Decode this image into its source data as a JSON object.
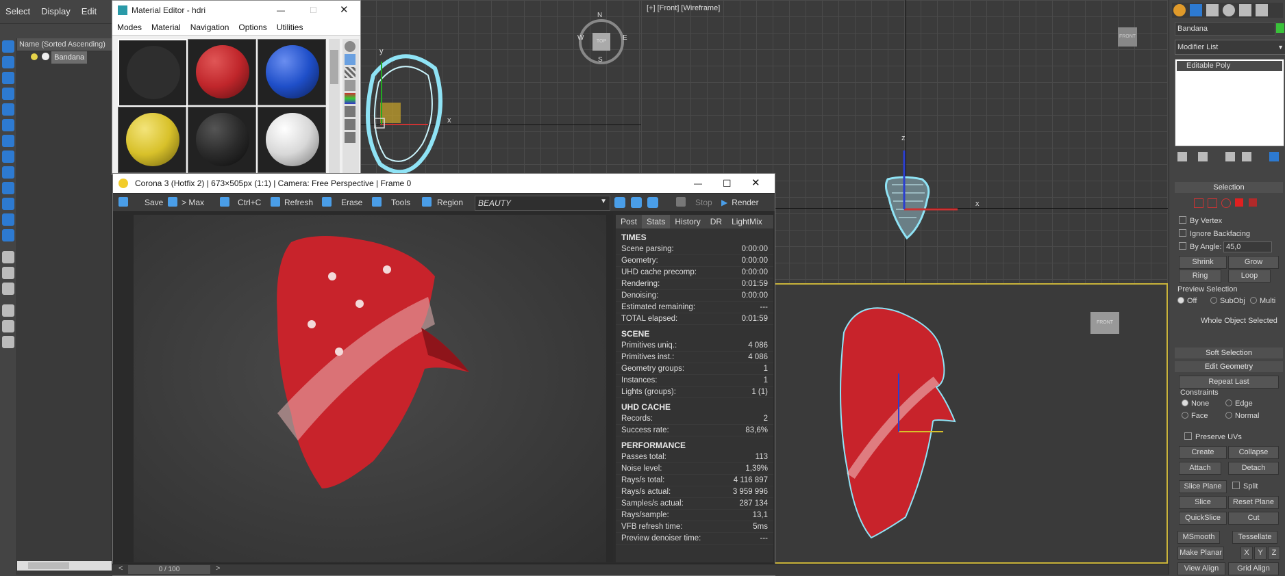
{
  "menu": {
    "items": [
      "Select",
      "Display",
      "Edit"
    ]
  },
  "explorer": {
    "header": "Name (Sorted Ascending)",
    "object": "Bandana"
  },
  "viewports": {
    "front_label": "[+] [Front] [Wireframe]",
    "compass": {
      "n": "N",
      "s": "S",
      "e": "E",
      "w": "W",
      "center": "TOP"
    },
    "viewcube_front": "FRONT",
    "axis_x": "x",
    "axis_y": "y",
    "axis_z": "z"
  },
  "material_editor": {
    "title": "Material Editor - hdri",
    "menu": [
      "Modes",
      "Material",
      "Navigation",
      "Options",
      "Utilities"
    ],
    "slots": [
      {
        "color": "#3a3a3a"
      },
      {
        "color": "#c0262b"
      },
      {
        "color": "#1f4fc9"
      },
      {
        "color": "#d8c12a"
      },
      {
        "color": "#2b2b2b"
      },
      {
        "color": "#d8d8d8"
      }
    ]
  },
  "vfb": {
    "title": "Corona 3 (Hotfix 2) | 673×505px (1:1) | Camera: Free Perspective | Frame 0",
    "toolbar": {
      "save": "Save",
      "max": "> Max",
      "copy": "Ctrl+C",
      "refresh": "Refresh",
      "erase": "Erase",
      "tools": "Tools",
      "region": "Region",
      "pass": "BEAUTY",
      "stop": "Stop",
      "render": "Render"
    },
    "tabs": [
      "Post",
      "Stats",
      "History",
      "DR",
      "LightMix"
    ],
    "sections": [
      {
        "title": "TIMES",
        "rows": [
          [
            "Scene parsing:",
            "0:00:00"
          ],
          [
            "Geometry:",
            "0:00:00"
          ],
          [
            "UHD cache precomp:",
            "0:00:00"
          ],
          [
            "Rendering:",
            "0:01:59"
          ],
          [
            "Denoising:",
            "0:00:00"
          ],
          [
            "Estimated remaining:",
            "---"
          ],
          [
            "TOTAL elapsed:",
            "0:01:59"
          ]
        ]
      },
      {
        "title": "SCENE",
        "rows": [
          [
            "Primitives uniq.:",
            "4 086"
          ],
          [
            "Primitives inst.:",
            "4 086"
          ],
          [
            "Geometry groups:",
            "1"
          ],
          [
            "Instances:",
            "1"
          ],
          [
            "Lights (groups):",
            "1 (1)"
          ]
        ]
      },
      {
        "title": "UHD CACHE",
        "rows": [
          [
            "Records:",
            "2"
          ],
          [
            "Success rate:",
            "83,6%"
          ]
        ]
      },
      {
        "title": "PERFORMANCE",
        "rows": [
          [
            "Passes total:",
            "113"
          ],
          [
            "Noise level:",
            "1,39%"
          ],
          [
            "Rays/s total:",
            "4 116 897"
          ],
          [
            "Rays/s actual:",
            "3 959 996"
          ],
          [
            "Samples/s actual:",
            "287 134"
          ],
          [
            "Rays/sample:",
            "13,1"
          ],
          [
            "VFB refresh time:",
            "5ms"
          ],
          [
            "Preview denoiser time:",
            "---"
          ]
        ]
      }
    ],
    "frame_counter": "0 / 100"
  },
  "command_panel": {
    "object_name": "Bandana",
    "modifier_list": "Modifier List",
    "stack_item": "Editable Poly",
    "selection_title": "Selection",
    "by_vertex": "By Vertex",
    "ignore_backfacing": "Ignore Backfacing",
    "by_angle": "By Angle:",
    "angle_value": "45,0",
    "shrink": "Shrink",
    "grow": "Grow",
    "ring": "Ring",
    "loop": "Loop",
    "preview_selection": "Preview Selection",
    "preview_opts": [
      "Off",
      "SubObj",
      "Multi"
    ],
    "whole_object": "Whole Object Selected",
    "soft_selection": "Soft Selection",
    "edit_geometry": "Edit Geometry",
    "repeat_last": "Repeat Last",
    "constraints": "Constraints",
    "constraint_opts": [
      "None",
      "Edge",
      "Face",
      "Normal"
    ],
    "preserve_uvs": "Preserve UVs",
    "create": "Create",
    "collapse": "Collapse",
    "attach": "Attach",
    "detach": "Detach",
    "slice_plane": "Slice Plane",
    "split": "Split",
    "slice": "Slice",
    "reset_plane": "Reset Plane",
    "quickslice": "QuickSlice",
    "cut": "Cut",
    "msmooth": "MSmooth",
    "tessellate": "Tessellate",
    "make_planar": "Make Planar",
    "x": "X",
    "y": "Y",
    "z": "Z",
    "view_align": "View Align",
    "grid_align": "Grid Align"
  },
  "colors": {
    "accent": "#2d7ad1",
    "bandana_red": "#c8232b",
    "wire": "#8fe3f5",
    "selection_yellow": "#d8c12a"
  }
}
